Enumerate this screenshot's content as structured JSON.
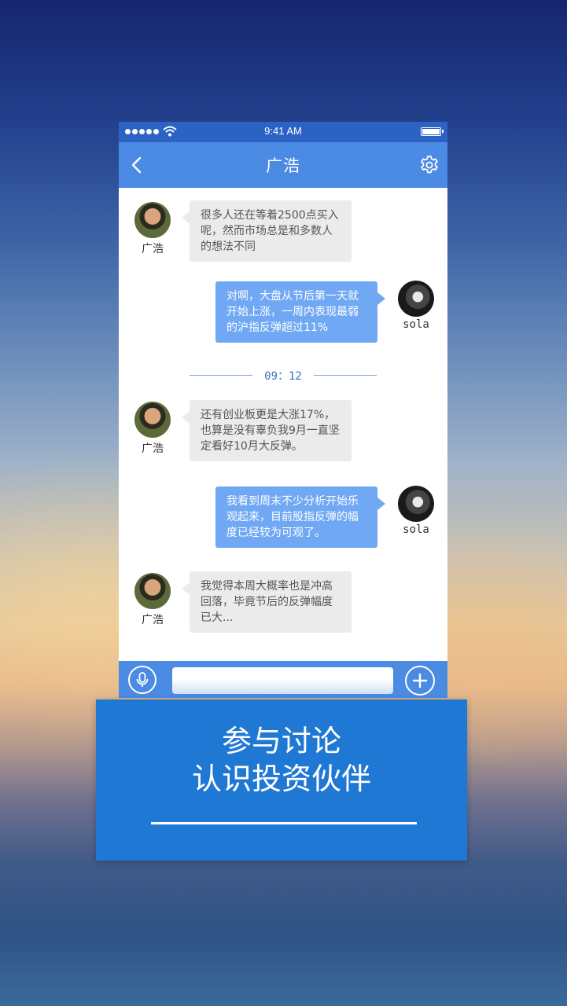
{
  "status_bar": {
    "time": "9:41 AM"
  },
  "nav": {
    "title": "广浩"
  },
  "messages": [
    {
      "sender": "广浩",
      "side": "left",
      "text": "很多人还在等着2500点买入呢，然而市场总是和多数人的想法不同"
    },
    {
      "sender": "sola",
      "side": "right",
      "text": "对啊，大盘从节后第一天就开始上涨，一周内表现最弱的沪指反弹超过11%"
    },
    {
      "sender": "广浩",
      "side": "left",
      "text": "还有创业板更是大涨17%，也算是没有辜负我9月一直坚定看好10月大反弹。"
    },
    {
      "sender": "sola",
      "side": "right",
      "text": "我看到周末不少分析开始乐观起来，目前股指反弹的幅度已经较为可观了。"
    },
    {
      "sender": "广浩",
      "side": "left",
      "text": "我觉得本周大概率也是冲高回落，毕竟节后的反弹幅度已大..."
    }
  ],
  "time_divider": "09：12",
  "input": {
    "placeholder": ""
  },
  "promo": {
    "line1": "参与讨论",
    "line2": "认识投资伙伴"
  },
  "colors": {
    "nav": "#4b8be3",
    "status": "#2c62c4",
    "bubble_right": "#70a8f3",
    "bubble_left": "#ebebeb",
    "promo": "#1f78d4"
  }
}
